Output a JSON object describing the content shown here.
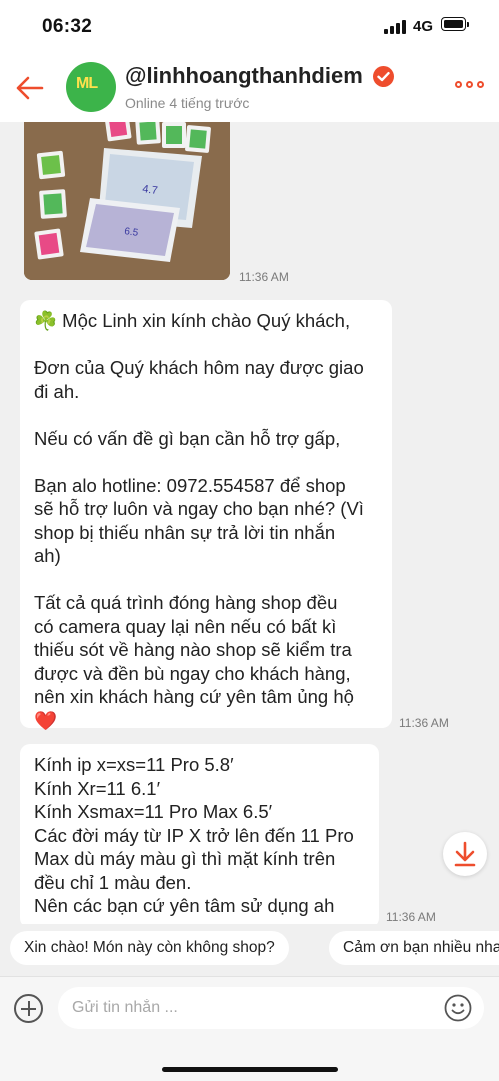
{
  "status_bar": {
    "time": "06:32",
    "network": "4G"
  },
  "header": {
    "shop_name": "@linhhoangthanhdiem",
    "online_status": "Online 4 tiếng trước",
    "avatar_logo": "ML",
    "icons": {
      "back": "back-arrow-icon",
      "verified": "verified-check-icon",
      "more": "more-dots-icon"
    }
  },
  "chat": {
    "messages": [
      {
        "type": "image",
        "description_icon": "product-photo",
        "time": "11:36 AM"
      },
      {
        "type": "text",
        "lines": [
          "☘️ Mộc Linh xin kính chào Quý khách,",
          "",
          "Đơn của Quý khách hôm nay được giao",
          "đi ah.",
          "",
          "Nếu có vấn đề gì bạn cần hỗ trợ gấp,",
          "",
          "Bạn alo hotline: 0972.554587 để shop",
          "sẽ hỗ trợ luôn và ngay cho bạn nhé? (Vì",
          "shop bị thiếu nhân sự trả lời tin nhắn",
          "ah)",
          "",
          "Tất cả quá trình đóng hàng shop đều",
          "có camera quay lại nên nếu có bất kì",
          "thiếu sót về hàng nào shop sẽ kiểm tra",
          "được và đền bù ngay cho khách hàng,",
          "nên xin khách hàng cứ yên tâm ủng hộ",
          "❤️"
        ],
        "time": "11:36 AM"
      },
      {
        "type": "text",
        "lines": [
          "Kính ip x=xs=11 Pro 5.8′",
          "Kính Xr=11 6.1′",
          "Kính Xsmax=11 Pro Max 6.5′",
          "Các đời máy từ IP X trở lên đến 11 Pro",
          "Max dù máy màu gì thì mặt kính trên",
          "đều chỉ 1 màu đen.",
          "Nên các bạn cứ yên tâm sử dụng ah"
        ],
        "time": "11:36 AM"
      }
    ],
    "scroll_down_icon": "arrow-down-icon"
  },
  "quick_replies": [
    "Xin chào! Món này còn không shop?",
    "Cảm ơn bạn nhiều nha"
  ],
  "input": {
    "placeholder": "Gửi tin nhắn ...",
    "icons": {
      "add": "add-circle-icon",
      "emoji": "emoji-smile-icon"
    }
  },
  "colors": {
    "accent": "#ee4d2d",
    "bubble": "#ffffff",
    "chat_bg": "#f0f0f0"
  }
}
